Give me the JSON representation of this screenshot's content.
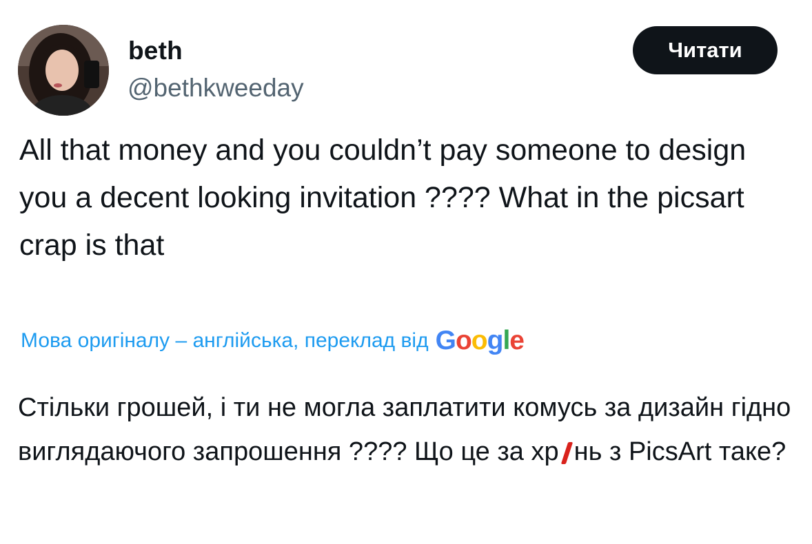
{
  "author": {
    "display_name": "beth",
    "handle": "@bethkweeday",
    "avatar_icon": "profile-photo"
  },
  "follow_button": {
    "label": "Читати"
  },
  "tweet": {
    "text": "All that money and you couldn’t pay someone to design you a decent looking invitation ???? What in the picsart crap is that"
  },
  "translation": {
    "label": "Мова оригіналу – англійська, переклад від",
    "provider": "Google",
    "provider_colors": [
      "#4285F4",
      "#EA4335",
      "#FBBC05",
      "#4285F4",
      "#34A853",
      "#EA4335"
    ],
    "text_before_mark": "Стільки грошей, і ти не могла заплатити комусь за дизайн гідно виглядаючого запрошення ???? Що це за хр",
    "text_after_mark": "нь з PicsArt таке?",
    "mark_color": "#d9221c"
  }
}
